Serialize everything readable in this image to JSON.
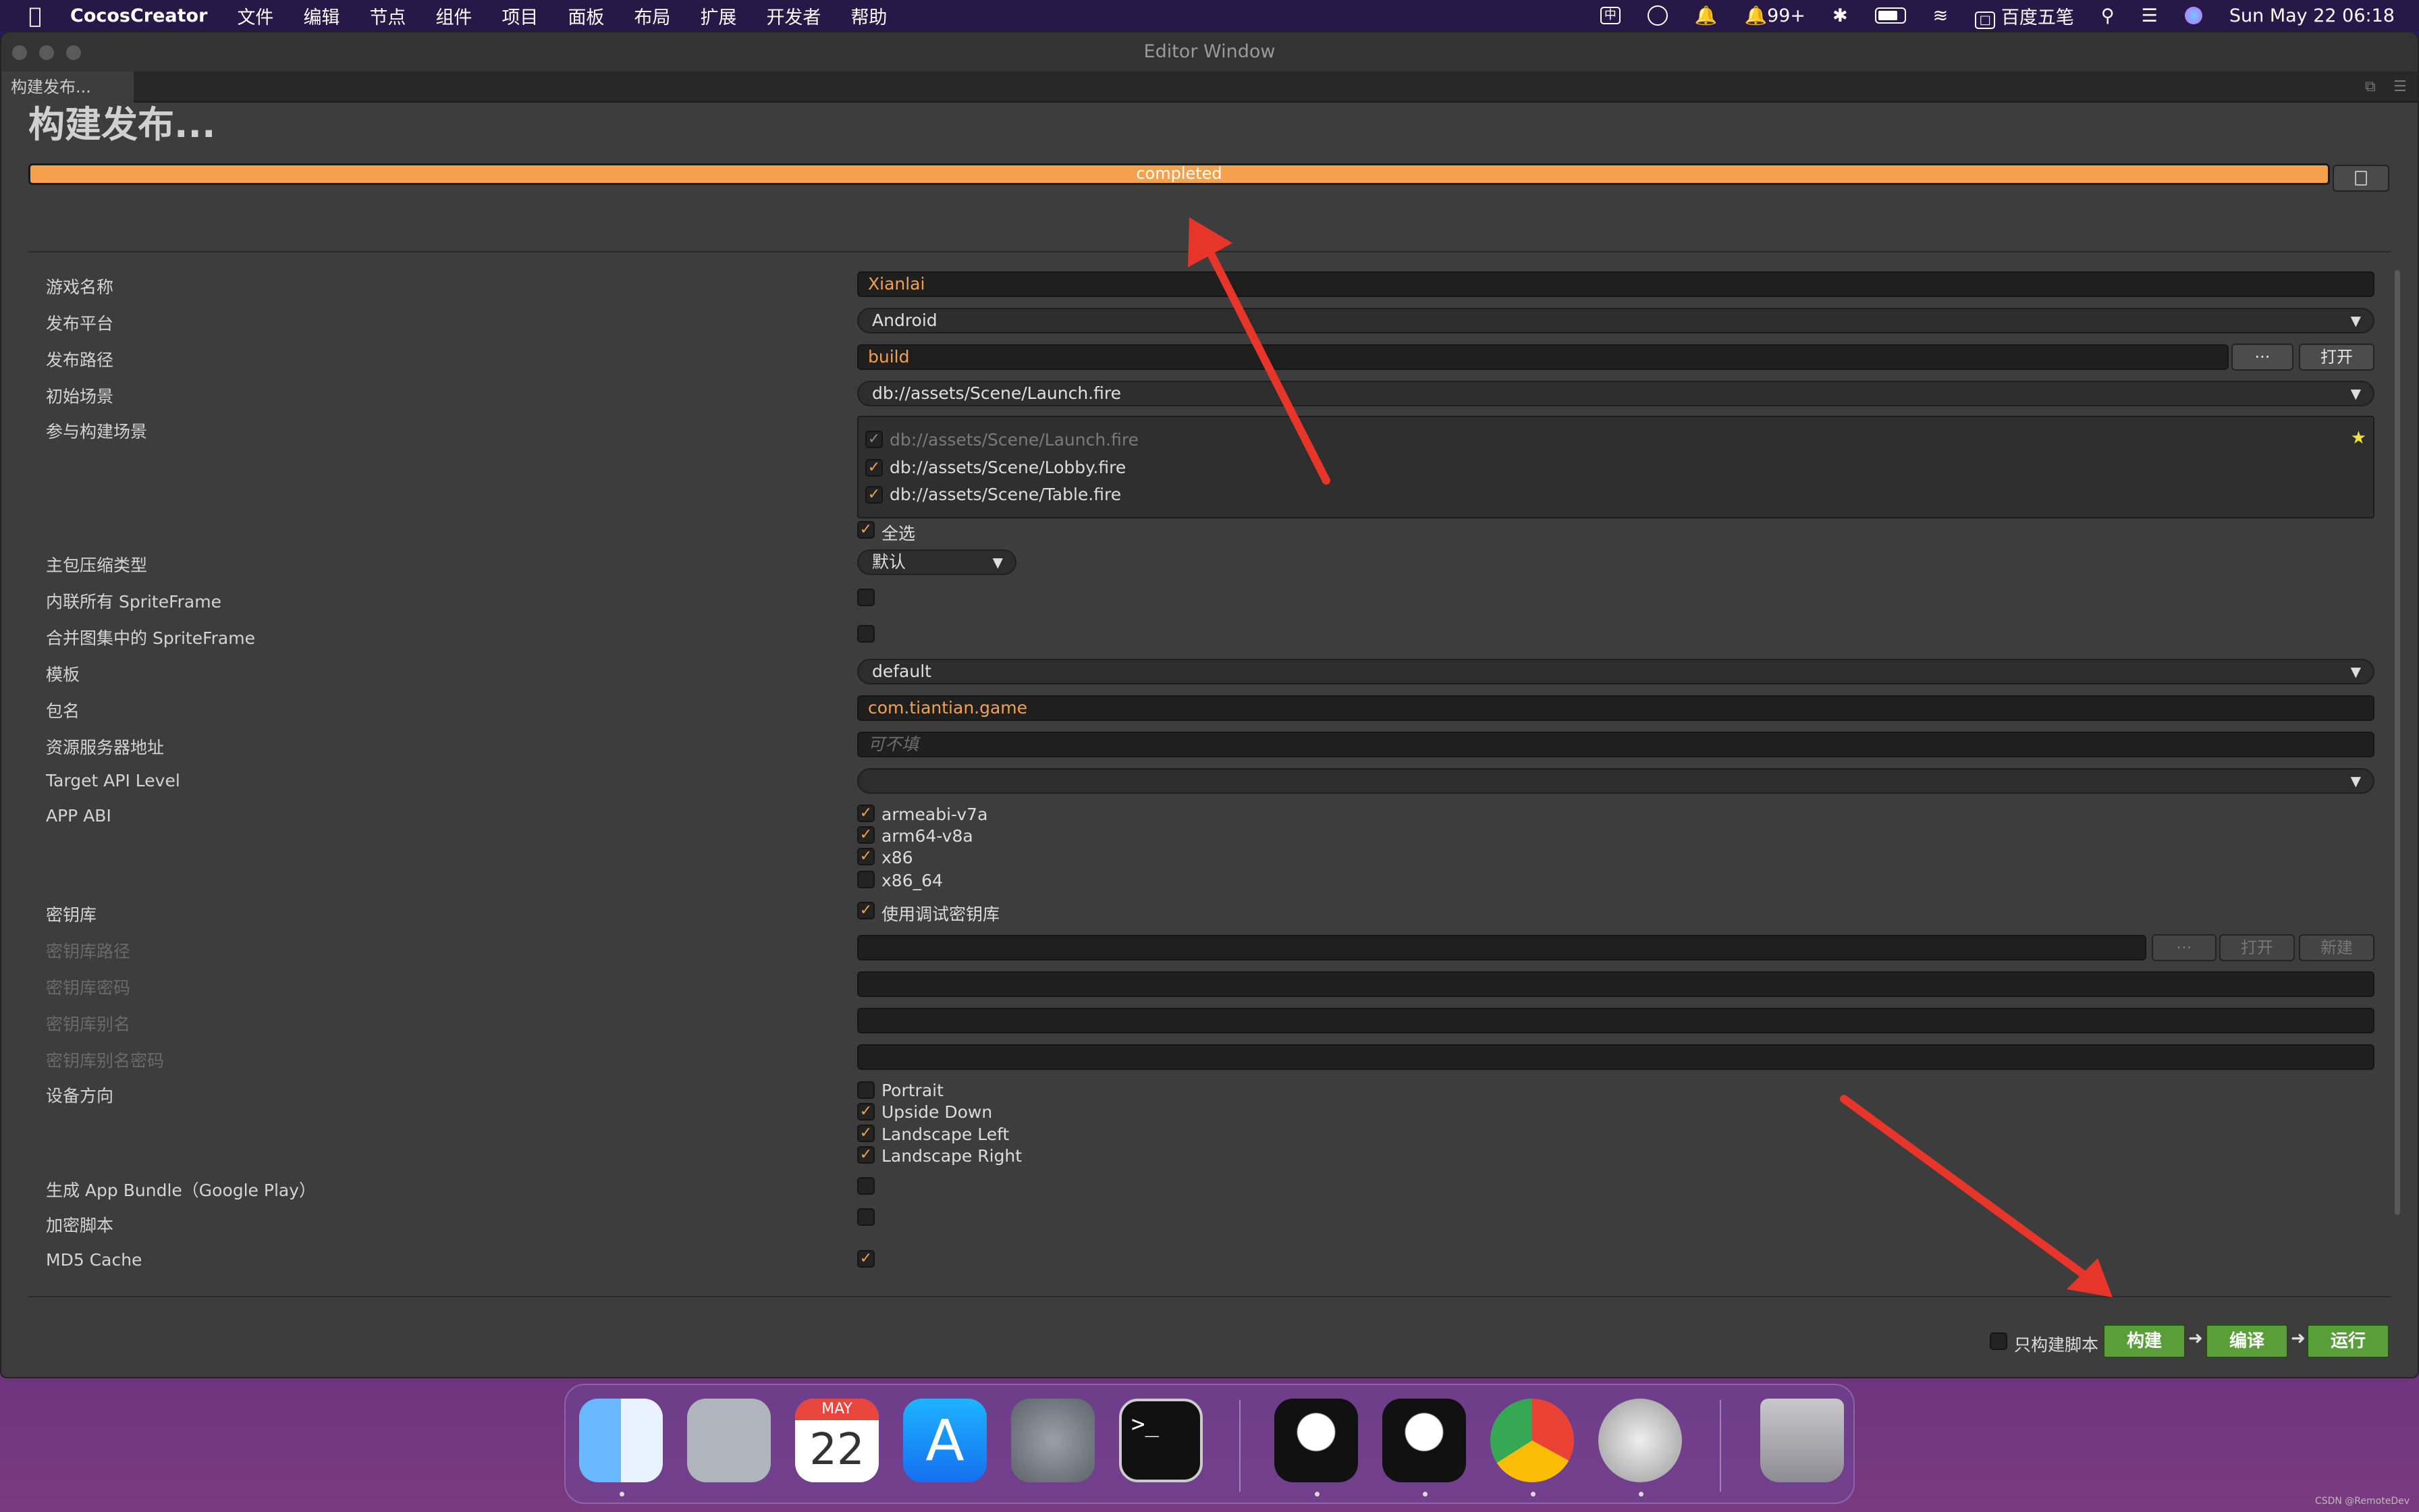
{
  "menubar": {
    "app_name": "CocosCreator",
    "menus": [
      "文件",
      "编辑",
      "节点",
      "组件",
      "项目",
      "面板",
      "布局",
      "扩展",
      "开发者",
      "帮助"
    ],
    "notification_count": "99+",
    "input_method": "百度五笔",
    "clock": "Sun May 22  06:18",
    "chinese_indicator": "中"
  },
  "window": {
    "title": "Editor Window",
    "tab_label": "构建发布...",
    "heading": "构建发布..."
  },
  "progress": {
    "text": "completed",
    "fraction": 1.0,
    "color": "#f5a04a"
  },
  "form": {
    "game_name": {
      "label": "游戏名称",
      "value": "Xianlai"
    },
    "platform": {
      "label": "发布平台",
      "value": "Android"
    },
    "build_path": {
      "label": "发布路径",
      "value": "build",
      "browse_label": "···",
      "open_label": "打开"
    },
    "start_scene": {
      "label": "初始场景",
      "value": "db://assets/Scene/Launch.fire"
    },
    "included_scenes": {
      "label": "参与构建场景",
      "items": [
        {
          "text": "db://assets/Scene/Launch.fire",
          "checked": true,
          "disabled": true
        },
        {
          "text": "db://assets/Scene/Lobby.fire",
          "checked": true,
          "disabled": false
        },
        {
          "text": "db://assets/Scene/Table.fire",
          "checked": true,
          "disabled": false
        }
      ],
      "select_all_label": "全选"
    },
    "compression": {
      "label": "主包压缩类型",
      "value": "默认"
    },
    "inline_spriteframe": {
      "label": "内联所有 SpriteFrame",
      "checked": false
    },
    "merge_spriteframe": {
      "label": "合并图集中的 SpriteFrame",
      "checked": false
    },
    "template": {
      "label": "模板",
      "value": "default"
    },
    "package_name": {
      "label": "包名",
      "value": "com.tiantian.game"
    },
    "resource_server": {
      "label": "资源服务器地址",
      "placeholder": "可不填"
    },
    "target_api": {
      "label": "Target API Level",
      "value": ""
    },
    "app_abi": {
      "label": "APP ABI",
      "options": [
        {
          "text": "armeabi-v7a",
          "checked": true
        },
        {
          "text": "arm64-v8a",
          "checked": true
        },
        {
          "text": "x86",
          "checked": true
        },
        {
          "text": "x86_64",
          "checked": false
        }
      ]
    },
    "keystore": {
      "label": "密钥库",
      "option_label": "使用调试密钥库",
      "checked": true
    },
    "keystore_path": {
      "label": "密钥库路径",
      "browse_label": "···",
      "open_label": "打开",
      "new_label": "新建"
    },
    "keystore_password": {
      "label": "密钥库密码"
    },
    "keystore_alias": {
      "label": "密钥库别名"
    },
    "keystore_alias_password": {
      "label": "密钥库别名密码"
    },
    "orientation": {
      "label": "设备方向",
      "options": [
        {
          "text": "Portrait",
          "checked": false
        },
        {
          "text": "Upside Down",
          "checked": true
        },
        {
          "text": "Landscape Left",
          "checked": true
        },
        {
          "text": "Landscape Right",
          "checked": true
        }
      ]
    },
    "app_bundle": {
      "label": "生成 App Bundle（Google Play）",
      "checked": false
    },
    "encrypt_js": {
      "label": "加密脚本",
      "checked": false
    },
    "md5_cache": {
      "label": "MD5 Cache",
      "checked": true
    }
  },
  "footer": {
    "script_only_label": "只构建脚本",
    "build_label": "构建",
    "compile_label": "编译",
    "run_label": "运行"
  },
  "colors": {
    "accent": "#f5a04a",
    "green_button": "#5a9e3a",
    "annotation_red": "#e8352a"
  },
  "dock": {
    "apps": [
      "finder-icon",
      "launchpad-icon",
      "calendar-icon",
      "app-store-icon",
      "system-preferences-icon",
      "terminal-icon",
      "qq-icon",
      "qq-icon",
      "chrome-icon",
      "cocos-icon",
      "trash-icon"
    ],
    "calendar_month": "MAY",
    "calendar_day": "22",
    "terminal_prompt": ">_"
  },
  "watermark": "CSDN @RemoteDev"
}
